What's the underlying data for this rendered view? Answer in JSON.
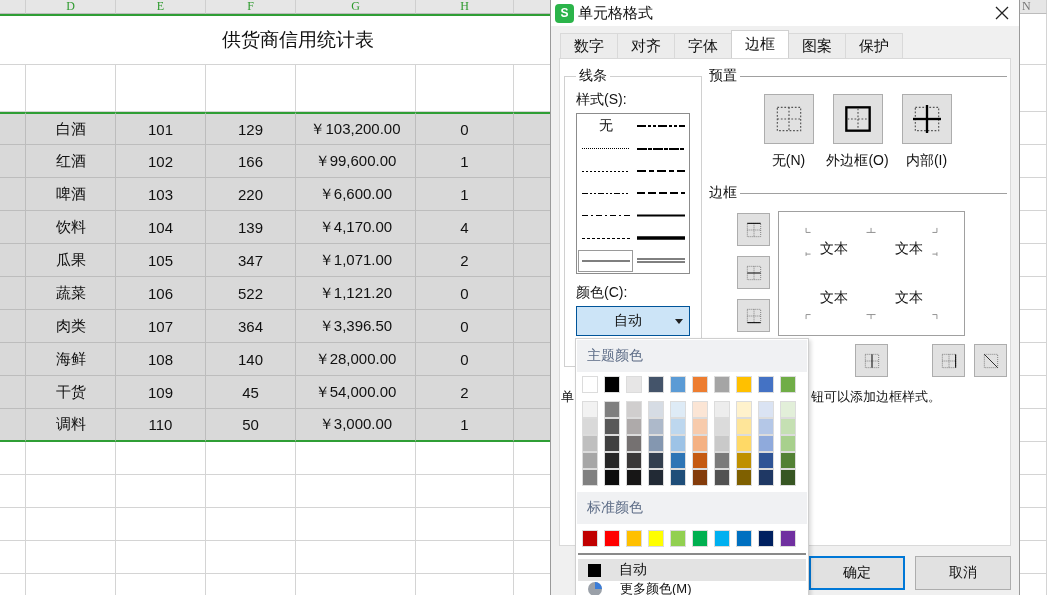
{
  "sheet": {
    "columns": [
      {
        "label": "D",
        "selected": true
      },
      {
        "label": "E",
        "selected": true
      },
      {
        "label": "F",
        "selected": true
      },
      {
        "label": "G",
        "selected": true
      },
      {
        "label": "H",
        "selected": true
      },
      {
        "label": "N",
        "selected": false
      }
    ],
    "title": "供货商信用统计表",
    "rows": [
      {
        "selected": true,
        "cells": [
          "白酒",
          "101",
          "129",
          "￥103,200.00",
          "0"
        ]
      },
      {
        "selected": true,
        "cells": [
          "红酒",
          "102",
          "166",
          "￥99,600.00",
          "1"
        ]
      },
      {
        "selected": true,
        "cells": [
          "啤酒",
          "103",
          "220",
          "￥6,600.00",
          "1"
        ]
      },
      {
        "selected": true,
        "cells": [
          "饮料",
          "104",
          "139",
          "￥4,170.00",
          "4"
        ]
      },
      {
        "selected": true,
        "cells": [
          "瓜果",
          "105",
          "347",
          "￥1,071.00",
          "2"
        ]
      },
      {
        "selected": true,
        "cells": [
          "蔬菜",
          "106",
          "522",
          "￥1,121.20",
          "0"
        ]
      },
      {
        "selected": true,
        "cells": [
          "肉类",
          "107",
          "364",
          "￥3,396.50",
          "0"
        ]
      },
      {
        "selected": true,
        "cells": [
          "海鲜",
          "108",
          "140",
          "￥28,000.00",
          "0"
        ]
      },
      {
        "selected": true,
        "cells": [
          "干货",
          "109",
          "45",
          "￥54,000.00",
          "2"
        ]
      },
      {
        "selected": true,
        "cells": [
          "调料",
          "110",
          "50",
          "￥3,000.00",
          "1"
        ]
      }
    ]
  },
  "dialog": {
    "icon_letter": "S",
    "title": "单元格格式",
    "tabs": [
      {
        "label": "数字",
        "selected": false
      },
      {
        "label": "对齐",
        "selected": false
      },
      {
        "label": "字体",
        "selected": false
      },
      {
        "label": "边框",
        "selected": true
      },
      {
        "label": "图案",
        "selected": false
      },
      {
        "label": "保护",
        "selected": false
      }
    ],
    "line_group": {
      "title": "线条",
      "style_label": "样式(S):",
      "styles": [
        {
          "kind": "none",
          "label": "无",
          "selected": false
        },
        {
          "kind": "medium-dash-dot-dot",
          "selected": false
        },
        {
          "kind": "hair",
          "selected": false
        },
        {
          "kind": "slanted-dash-dot",
          "selected": false
        },
        {
          "kind": "dotted",
          "selected": false
        },
        {
          "kind": "medium-dash-dot",
          "selected": false
        },
        {
          "kind": "dash-dot-dot",
          "selected": false
        },
        {
          "kind": "medium-dashed",
          "selected": false
        },
        {
          "kind": "dash-dot",
          "selected": false
        },
        {
          "kind": "medium",
          "selected": false
        },
        {
          "kind": "dashed",
          "selected": false
        },
        {
          "kind": "thick",
          "selected": false
        },
        {
          "kind": "thin",
          "selected": true
        },
        {
          "kind": "double",
          "selected": false
        }
      ],
      "color_label": "颜色(C):",
      "color_value": "自动"
    },
    "preset": {
      "title": "预置",
      "buttons": [
        {
          "kind": "none",
          "label": "无(N)"
        },
        {
          "kind": "outline",
          "label": "外边框(O)"
        },
        {
          "kind": "inside",
          "label": "内部(I)"
        }
      ]
    },
    "border": {
      "title": "边框",
      "side_buttons": [
        {
          "kind": "top"
        },
        {
          "kind": "middle-h"
        },
        {
          "kind": "bottom"
        }
      ],
      "bottom_buttons": [
        {
          "kind": "middle-v"
        },
        {
          "kind": "right"
        },
        {
          "kind": "diagonal-down"
        }
      ],
      "preview_texts": [
        "文本",
        "文本",
        "文本",
        "文本"
      ]
    },
    "hint_parts": [
      "单",
      "钮可以添加边框样式。"
    ],
    "buttons": [
      {
        "label": "确定",
        "kind": "default"
      },
      {
        "label": "取消",
        "kind": "normal"
      }
    ],
    "color_menu": {
      "theme_title": "主题颜色",
      "theme": [
        {
          "color": "#ffffff"
        },
        {
          "color": "#000000"
        },
        {
          "color": "#e7e6e6"
        },
        {
          "color": "#44546a"
        },
        {
          "color": "#5b9bd5"
        },
        {
          "color": "#ed7d31"
        },
        {
          "color": "#a5a5a5"
        },
        {
          "color": "#ffc000"
        },
        {
          "color": "#4472c4"
        },
        {
          "color": "#70ad47"
        }
      ],
      "shade_rows": [
        {
          "swatches": [
            {
              "color": "#f2f2f2"
            },
            {
              "color": "#7f7f7f"
            },
            {
              "color": "#d0cece"
            },
            {
              "color": "#d6dce4"
            },
            {
              "color": "#deebf6"
            },
            {
              "color": "#fbe5d5"
            },
            {
              "color": "#ededed"
            },
            {
              "color": "#fff2cc"
            },
            {
              "color": "#dae3f3"
            },
            {
              "color": "#e2efd9"
            }
          ]
        },
        {
          "swatches": [
            {
              "color": "#d9d9d9"
            },
            {
              "color": "#595959"
            },
            {
              "color": "#aeaaaa"
            },
            {
              "color": "#adb9ca"
            },
            {
              "color": "#bdd7ee"
            },
            {
              "color": "#f7cbac"
            },
            {
              "color": "#dbdbdb"
            },
            {
              "color": "#fee599"
            },
            {
              "color": "#b4c7e7"
            },
            {
              "color": "#c5e0b3"
            }
          ]
        },
        {
          "swatches": [
            {
              "color": "#bfbfbf"
            },
            {
              "color": "#404040"
            },
            {
              "color": "#757171"
            },
            {
              "color": "#8497b0"
            },
            {
              "color": "#9dc3e6"
            },
            {
              "color": "#f4b183"
            },
            {
              "color": "#c9c9c9"
            },
            {
              "color": "#ffd966"
            },
            {
              "color": "#8faadc"
            },
            {
              "color": "#a8d08d"
            }
          ]
        },
        {
          "swatches": [
            {
              "color": "#a6a6a6"
            },
            {
              "color": "#262626"
            },
            {
              "color": "#3a3838"
            },
            {
              "color": "#333f4f"
            },
            {
              "color": "#2e75b5"
            },
            {
              "color": "#c55a11"
            },
            {
              "color": "#7b7b7b"
            },
            {
              "color": "#bf9000"
            },
            {
              "color": "#2f5496"
            },
            {
              "color": "#538135"
            }
          ]
        },
        {
          "swatches": [
            {
              "color": "#808080"
            },
            {
              "color": "#0d0d0d"
            },
            {
              "color": "#171616"
            },
            {
              "color": "#222a35"
            },
            {
              "color": "#1f4e79"
            },
            {
              "color": "#843c0b"
            },
            {
              "color": "#525252"
            },
            {
              "color": "#7f6000"
            },
            {
              "color": "#1f3864"
            },
            {
              "color": "#375623"
            }
          ]
        }
      ],
      "standard_title": "标准颜色",
      "standard": [
        {
          "color": "#c00000"
        },
        {
          "color": "#ff0000"
        },
        {
          "color": "#ffc000"
        },
        {
          "color": "#ffff00"
        },
        {
          "color": "#92d050"
        },
        {
          "color": "#00b050"
        },
        {
          "color": "#00b0f0"
        },
        {
          "color": "#0070c0"
        },
        {
          "color": "#002060"
        },
        {
          "color": "#7030a0"
        }
      ],
      "items": [
        {
          "kind": "auto",
          "label": "自动",
          "selected": true
        },
        {
          "kind": "more",
          "label": "更多颜色(M)",
          "selected": false
        }
      ]
    }
  }
}
